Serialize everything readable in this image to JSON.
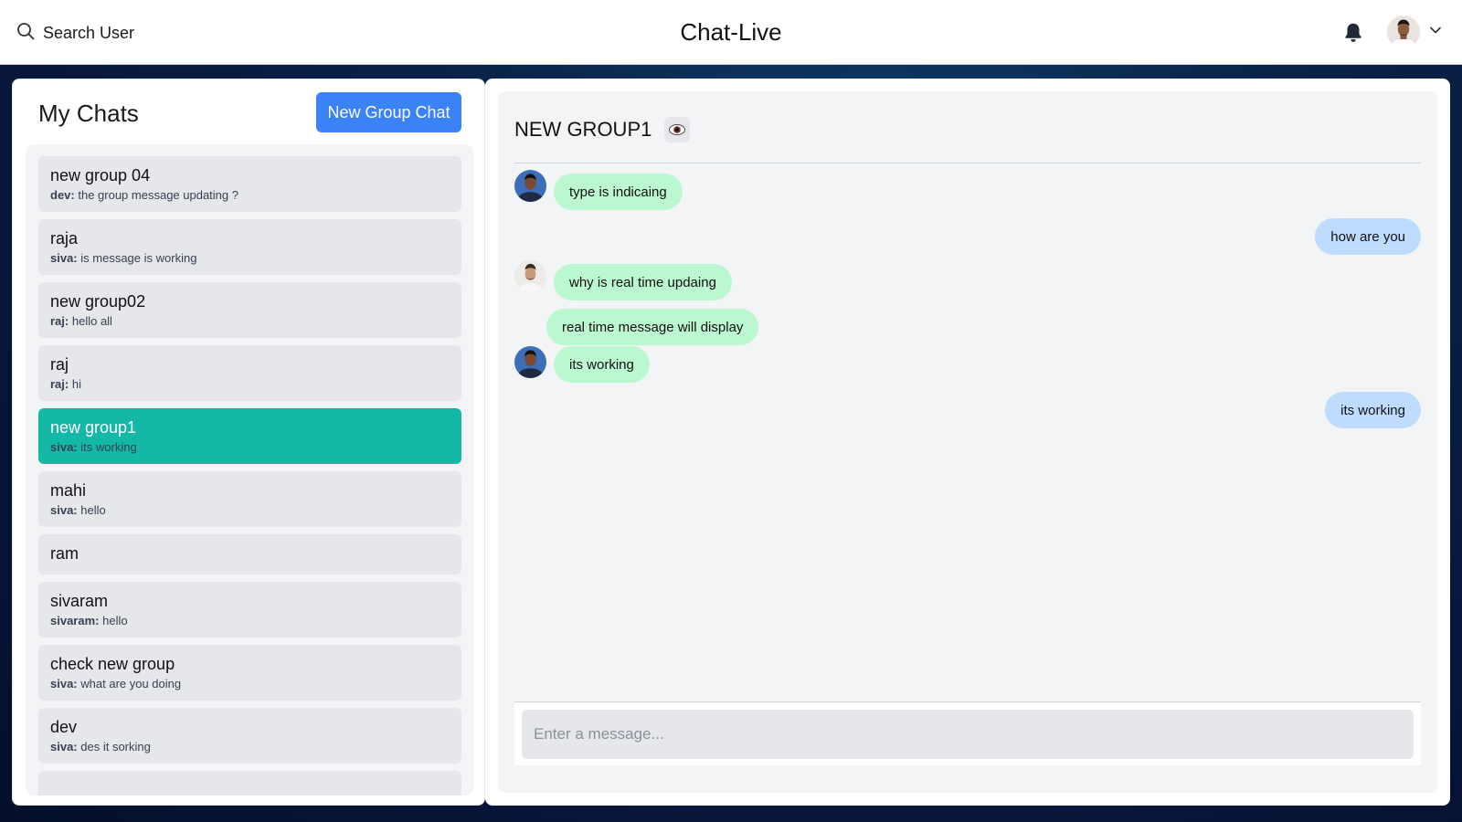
{
  "header": {
    "search_label": "Search User",
    "app_title": "Chat-Live"
  },
  "sidebar": {
    "title": "My Chats",
    "new_group_label": "New Group Chat",
    "chats": [
      {
        "name": "new group 04",
        "sender": "dev:",
        "message": "the group message updating ?"
      },
      {
        "name": "raja",
        "sender": "siva:",
        "message": "is message is working"
      },
      {
        "name": "new group02",
        "sender": "raj:",
        "message": "hello all"
      },
      {
        "name": "raj",
        "sender": "raj:",
        "message": "hi"
      },
      {
        "name": "new group1",
        "sender": "siva:",
        "message": "its working",
        "active": true
      },
      {
        "name": "mahi",
        "sender": "siva:",
        "message": "hello"
      },
      {
        "name": "ram"
      },
      {
        "name": "sivaram",
        "sender": "sivaram:",
        "message": "hello"
      },
      {
        "name": "check new group",
        "sender": "siva:",
        "message": "what are you doing"
      },
      {
        "name": "dev",
        "sender": "siva:",
        "message": "des it sorking"
      }
    ]
  },
  "conversation": {
    "title": "NEW GROUP1",
    "messages": [
      {
        "text": "type is indicaing",
        "side": "left"
      },
      {
        "text": "how are you",
        "side": "right"
      },
      {
        "text": "why is real time updaing",
        "side": "left"
      },
      {
        "text": "real time message will display",
        "side": "left"
      },
      {
        "text": "its working",
        "side": "left"
      },
      {
        "text": "its working",
        "side": "right"
      }
    ],
    "input_placeholder": "Enter a message..."
  },
  "colors": {
    "accent_blue": "#3b82f6",
    "active_chat": "#14b8a6",
    "received_bubble": "#bbf7d0",
    "sent_bubble": "#bfdbfe"
  }
}
